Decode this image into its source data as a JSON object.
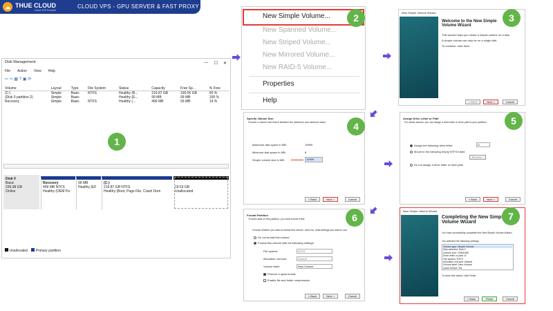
{
  "banner": {
    "brand": "THUE CLOUD",
    "tagline": "Cloud VPS Provider",
    "headline": "CLOUD VPS - GPU SERVER & FAST PROXY"
  },
  "steps": [
    "1",
    "2",
    "3",
    "4",
    "5",
    "6",
    "7"
  ],
  "dm": {
    "title": "Disk Management",
    "menu": [
      "File",
      "Action",
      "View",
      "Help"
    ],
    "headers": [
      "Volume",
      "Layout",
      "Type",
      "File System",
      "Status",
      "Capacity",
      "Free Sp...",
      "% Free"
    ],
    "rows": [
      [
        "(C:)",
        "Simple",
        "Basic",
        "NTFS",
        "Healthy (B...",
        "219.87 GB",
        "190.55 GB",
        "90 %"
      ],
      [
        "(Disk 0 partition 2)",
        "Simple",
        "Basic",
        "",
        "Healthy (E...",
        "99 MB",
        "99 MB",
        "100 %"
      ],
      [
        "Recovery",
        "Simple",
        "Basic",
        "NTFS",
        "Healthy (...",
        "499 MB",
        "93 MB",
        "19 %"
      ]
    ],
    "disk": {
      "name": "Disk 0",
      "type": "Basic",
      "size": "239.98 GB",
      "status": "Online"
    },
    "parts": [
      {
        "name": "Recovery",
        "size": "499 MB NTFS",
        "status": "Healthy (OEM Pa"
      },
      {
        "name": "",
        "size": "99 MB",
        "status": "Healthy (EF"
      },
      {
        "name": "(C:)",
        "size": "219.87 GB NTFS",
        "status": "Healthy (Boot, Page File, Crash Dum"
      },
      {
        "name": "",
        "size": "19.53 GB",
        "status": "Unallocated"
      }
    ],
    "legend": [
      "Unallocated",
      "Primary partition"
    ]
  },
  "ctx": {
    "items": [
      "New Simple Volume...",
      "New Spanned Volume...",
      "New Striped Volume...",
      "New Mirrored Volume...",
      "New RAID-5 Volume...",
      "Properties",
      "Help"
    ]
  },
  "w3": {
    "title": "New Simple Volume Wizard",
    "heading": "Welcome to the New Simple Volume Wizard",
    "p1": "This wizard helps you create a simple volume on a disk.",
    "p2": "A simple volume can only be on a single disk.",
    "p3": "To continue, click Next.",
    "back": "< Back",
    "next": "Next >",
    "cancel": "Cancel"
  },
  "w4": {
    "heading": "Specify Volume Size",
    "sub": "Choose a volume size that is between the maximum and minimum sizes.",
    "max_label": "Maximum disk space in MB:",
    "max_val": "19999",
    "min_label": "Minimum disk space in MB:",
    "min_val": "8",
    "size_label": "Simple volume size in MB:",
    "size_val": "19999",
    "back": "< Back",
    "next": "Next >",
    "cancel": "Cancel"
  },
  "w5": {
    "heading": "Assign Drive Letter or Path",
    "sub": "For easier access, you can assign a drive letter or drive path to your partition.",
    "opt1": "Assign the following drive letter:",
    "letter": "D",
    "opt2": "Mount in the following empty NTFS folder:",
    "browse": "Browse...",
    "opt3": "Do not assign a drive letter or drive path",
    "back": "< Back",
    "next": "Next >",
    "cancel": "Cancel"
  },
  "w6": {
    "heading": "Format Partition",
    "sub": "To store data on this partition, you must format it first.",
    "intro": "Choose whether you want to format this volume, and if so, what settings you want to use.",
    "opt1": "Do not format this volume",
    "opt2": "Format this volume with the following settings:",
    "fs_label": "File system:",
    "fs_val": "NTFS",
    "au_label": "Allocation unit size:",
    "au_val": "Default",
    "vl_label": "Volume label:",
    "vl_val": "New Volume",
    "chk1": "Perform a quick format",
    "chk2": "Enable file and folder compression",
    "back": "< Back",
    "next": "Next >",
    "cancel": "Cancel"
  },
  "w7": {
    "title": "New Simple Volume Wizard",
    "heading": "Completing the New Simple Volume Wizard",
    "p1": "You have successfully completed the New Simple Volume Wizard.",
    "p2": "You selected the following settings:",
    "settings": [
      "Volume type: Simple Volume",
      "Disk selected: Disk 0",
      "Volume size: 19999 MB",
      "Drive letter or path: D:",
      "File system: NTFS",
      "Allocation unit size: Default",
      "Volume label: New Volume",
      "Quick format: Yes"
    ],
    "p3": "To close this wizard, click Finish.",
    "back": "< Back",
    "finish": "Finish",
    "cancel": "Cancel"
  }
}
